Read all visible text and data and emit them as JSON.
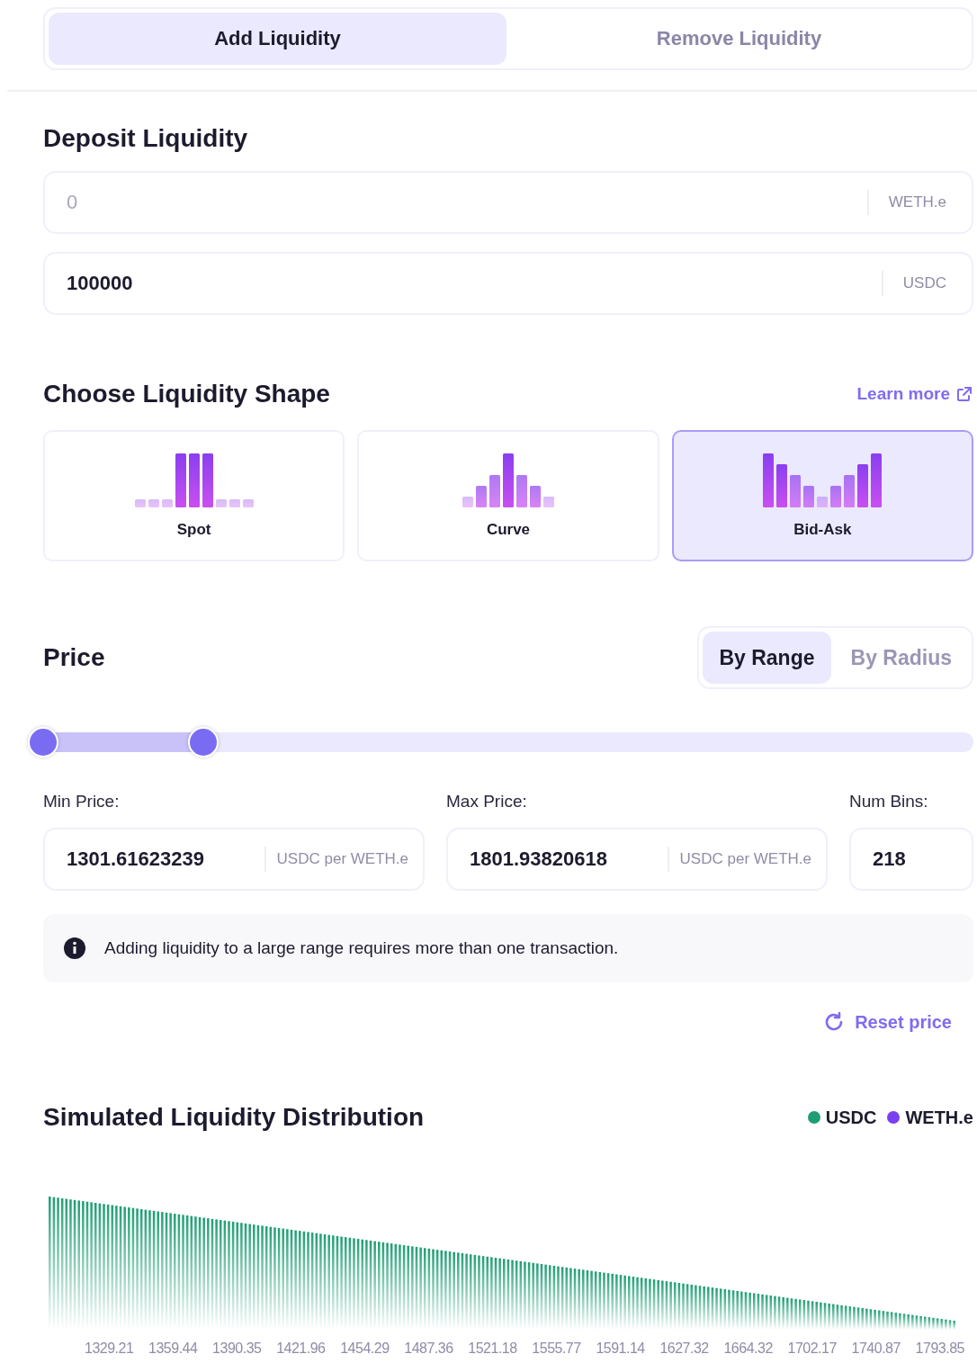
{
  "tabs": [
    {
      "label": "Add Liquidity",
      "selected": true
    },
    {
      "label": "Remove Liquidity",
      "selected": false
    }
  ],
  "deposit": {
    "title": "Deposit Liquidity",
    "inputs": [
      {
        "placeholder": "0",
        "token": "WETH.e"
      },
      {
        "value": "100000",
        "token": "USDC"
      }
    ]
  },
  "shape": {
    "title": "Choose Liquidity Shape",
    "learn_more": "Learn more",
    "options": [
      {
        "kind": "spot",
        "label": "Spot",
        "selected": false
      },
      {
        "kind": "curve",
        "label": "Curve",
        "selected": false
      },
      {
        "kind": "bid-ask",
        "label": "Bid-Ask",
        "selected": true
      }
    ]
  },
  "price": {
    "title": "Price",
    "modes": [
      {
        "label": "By Range",
        "selected": true
      },
      {
        "label": "By Radius",
        "selected": false
      }
    ],
    "handles": [
      {
        "level": 0
      },
      {
        "level": 0.172
      }
    ],
    "fields": [
      {
        "label": "Min Price:",
        "value": "1301.61623239",
        "unit": "USDC per WETH.e"
      },
      {
        "label": "Max Price:",
        "value": "1801.93820618",
        "unit": "USDC per WETH.e"
      },
      {
        "label": "Num Bins:",
        "value": "218"
      }
    ],
    "notice": "Adding liquidity to a large range requires more than one transaction.",
    "reset": "Reset price"
  },
  "distribution": {
    "title": "Simulated Liquidity Distribution",
    "legend": [
      {
        "label": "USDC",
        "color": "#1f9e74"
      },
      {
        "label": "WETH.e",
        "color": "#7b3ff2"
      }
    ],
    "x_labels": [
      "1329.21",
      "1359.44",
      "1390.35",
      "1421.96",
      "1454.29",
      "1487.36",
      "1521.18",
      "1555.77",
      "1591.14",
      "1627.32",
      "1664.32",
      "1702.17",
      "1740.87",
      "1793.85"
    ]
  }
}
